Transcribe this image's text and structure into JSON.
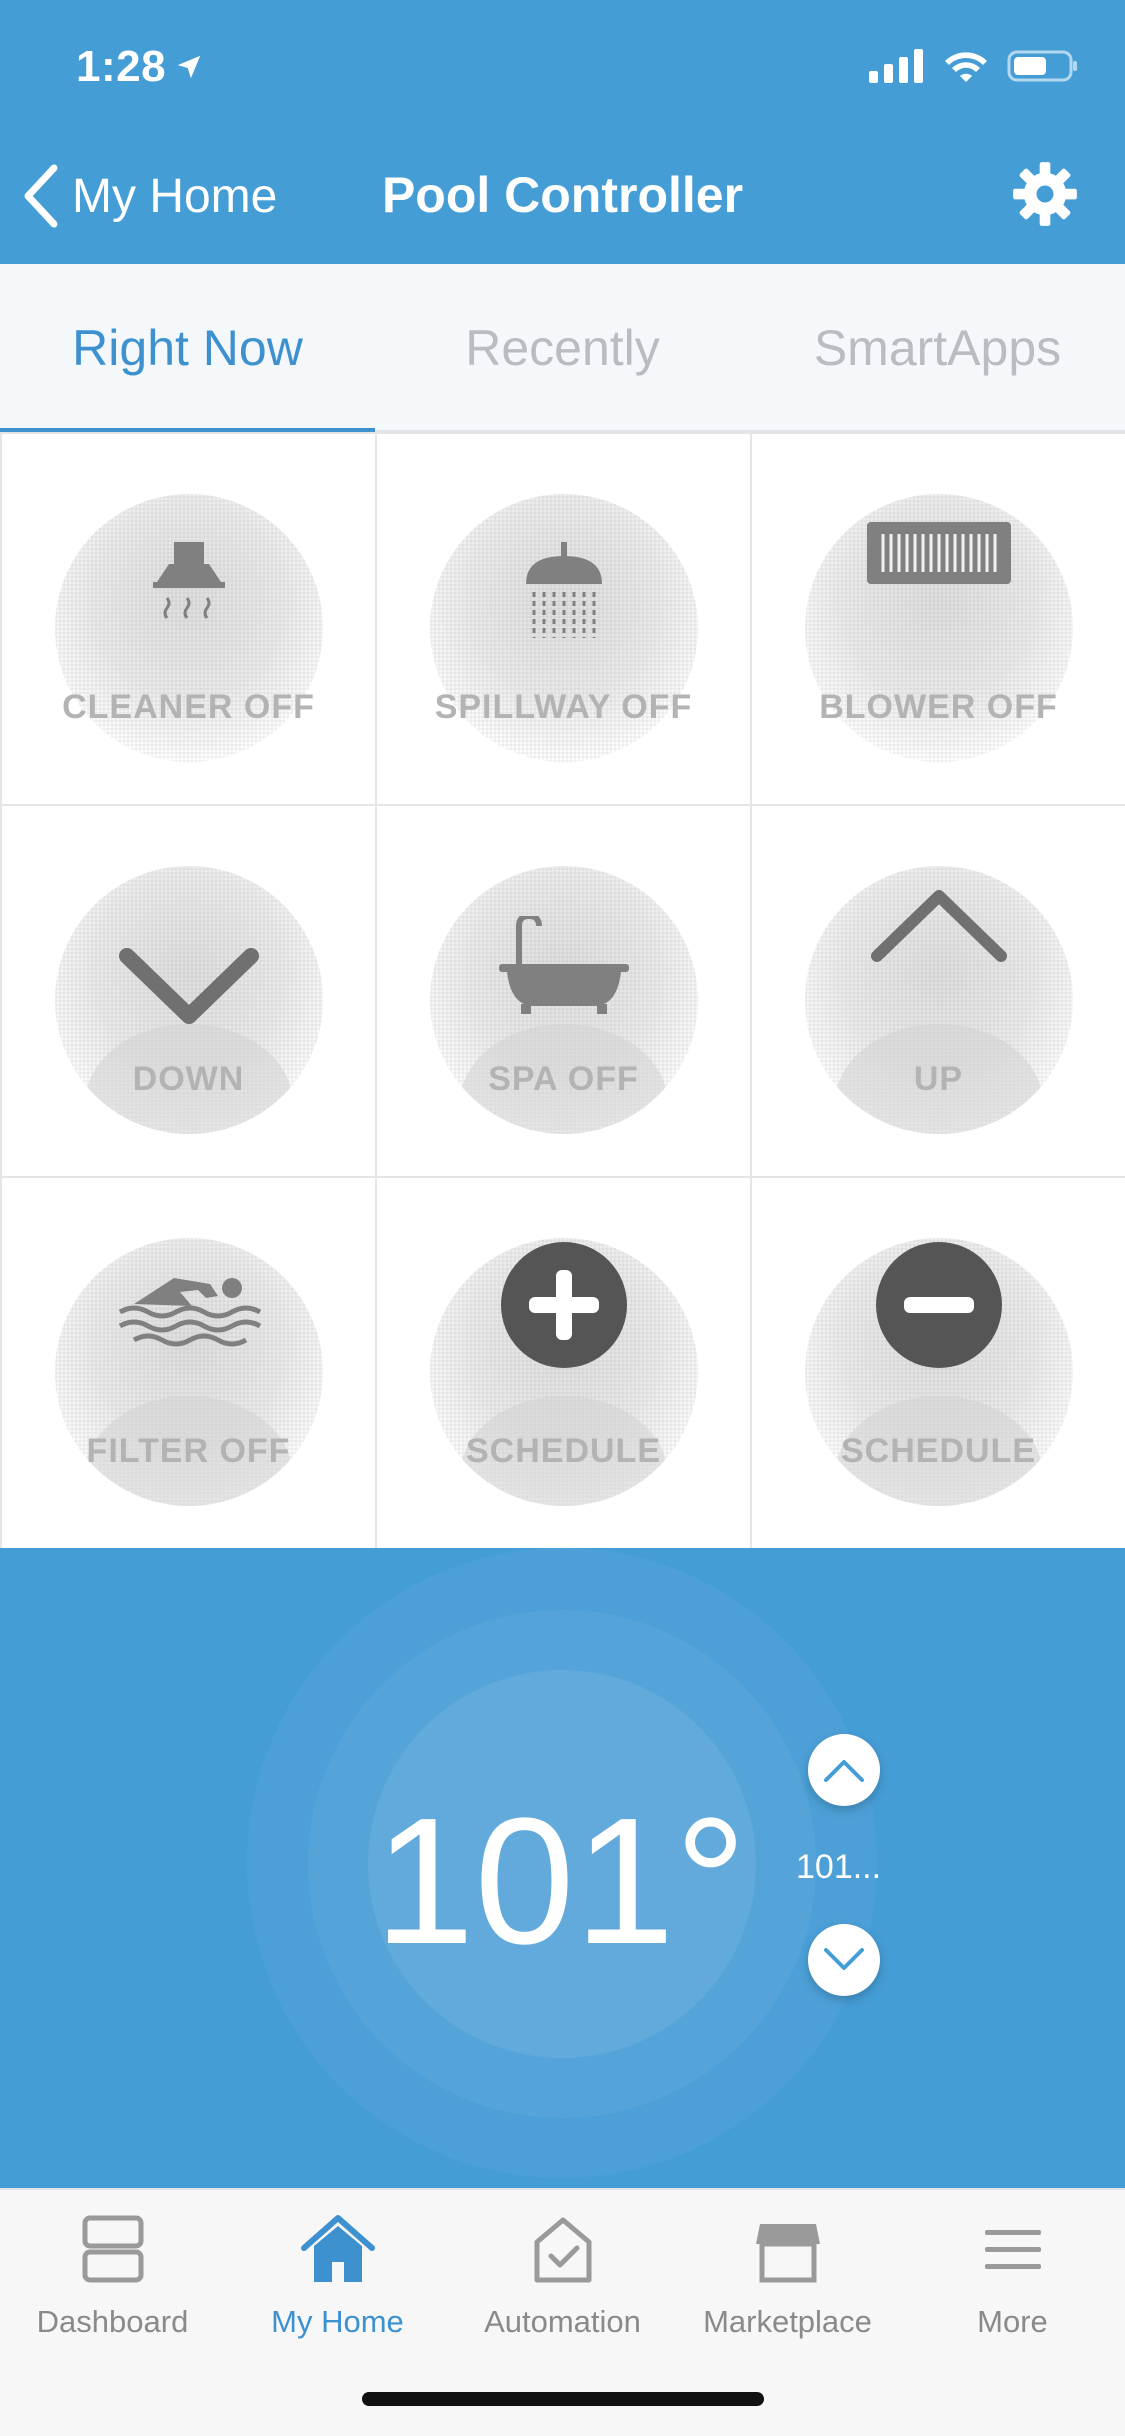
{
  "status_bar": {
    "time": "1:28"
  },
  "nav": {
    "back_label": "My Home",
    "title": "Pool Controller"
  },
  "tabs": [
    {
      "label": "Right Now",
      "active": true
    },
    {
      "label": "Recently",
      "active": false
    },
    {
      "label": "SmartApps",
      "active": false
    }
  ],
  "tiles": [
    {
      "label": "CLEANER OFF",
      "icon": "range-hood-icon"
    },
    {
      "label": "SPILLWAY OFF",
      "icon": "shower-icon"
    },
    {
      "label": "BLOWER OFF",
      "icon": "heater-vent-icon"
    },
    {
      "label": "DOWN",
      "icon": "chevron-down-icon"
    },
    {
      "label": "SPA OFF",
      "icon": "bathtub-icon"
    },
    {
      "label": "UP",
      "icon": "chevron-up-icon"
    },
    {
      "label": "FILTER OFF",
      "icon": "swimmer-icon"
    },
    {
      "label": "SCHEDULE",
      "icon": "plus-circle-icon"
    },
    {
      "label": "SCHEDULE",
      "icon": "minus-circle-icon"
    }
  ],
  "thermostat": {
    "temperature": "101°",
    "setpoint": "101..."
  },
  "tabbar": [
    {
      "label": "Dashboard",
      "icon": "dashboard-icon",
      "active": false
    },
    {
      "label": "My Home",
      "icon": "home-icon",
      "active": true
    },
    {
      "label": "Automation",
      "icon": "automation-icon",
      "active": false
    },
    {
      "label": "Marketplace",
      "icon": "marketplace-icon",
      "active": false
    },
    {
      "label": "More",
      "icon": "menu-icon",
      "active": false
    }
  ],
  "colors": {
    "brand": "#459dd6",
    "active": "#3e91cf"
  }
}
